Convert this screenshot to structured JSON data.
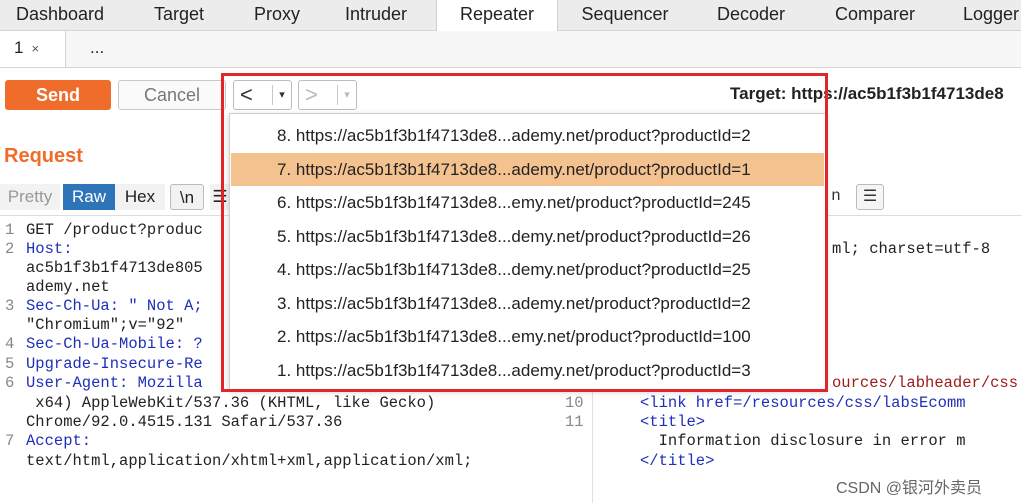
{
  "tabs": [
    {
      "label": "Dashboard",
      "active": false
    },
    {
      "label": "Target",
      "active": false
    },
    {
      "label": "Proxy",
      "active": false
    },
    {
      "label": "Intruder",
      "active": false
    },
    {
      "label": "Repeater",
      "active": true
    },
    {
      "label": "Sequencer",
      "active": false
    },
    {
      "label": "Decoder",
      "active": false
    },
    {
      "label": "Comparer",
      "active": false
    },
    {
      "label": "Logger",
      "active": false
    }
  ],
  "subtabs": {
    "tab1": "1",
    "close": "×",
    "more": "..."
  },
  "toolbar": {
    "send": "Send",
    "cancel": "Cancel",
    "target": "Target: https://ac5b1f3b1f4713de8"
  },
  "nav": {
    "back": "<",
    "forward": ">",
    "drop": "▾"
  },
  "request": {
    "title": "Request",
    "views": [
      "Pretty",
      "Raw",
      "Hex",
      "\\n",
      "☰"
    ],
    "active_view": "Raw",
    "lines": [
      {
        "num": "1",
        "text": "GET /product?produc"
      },
      {
        "num": "2",
        "text": "Host:"
      },
      {
        "num": "",
        "text": "ac5b1f3b1f4713de805"
      },
      {
        "num": "",
        "text": "ademy.net"
      },
      {
        "num": "3",
        "text": "Sec-Ch-Ua: \" Not A;"
      },
      {
        "num": "",
        "text": "\"Chromium\";v=\"92\""
      },
      {
        "num": "4",
        "text": "Sec-Ch-Ua-Mobile: ?"
      },
      {
        "num": "5",
        "text": "Upgrade-Insecure-Re"
      },
      {
        "num": "6",
        "text": "User-Agent: Mozilla"
      },
      {
        "num": "",
        "text": " x64) AppleWebKit/537.36 (KHTML, like Gecko)"
      },
      {
        "num": "",
        "text": "Chrome/92.0.4515.131 Safari/537.36"
      },
      {
        "num": "7",
        "text": "Accept:"
      },
      {
        "num": "",
        "text": "text/html,application/xhtml+xml,application/xml;"
      }
    ]
  },
  "response": {
    "view_icons": [
      "n",
      "☰"
    ],
    "line_right_top": "ml; charset=utf-8",
    "line_css": "ources/labheader/css",
    "line_nums": [
      "10",
      "11"
    ],
    "line10": "<link href=/resources/css/labsEcomm",
    "line11a": "<title>",
    "line11b": "  Information disclosure in error m",
    "line11c": "</title>"
  },
  "history": [
    {
      "label": "8. https://ac5b1f3b1f4713de8...ademy.net/product?productId=2",
      "selected": false
    },
    {
      "label": "7. https://ac5b1f3b1f4713de8...ademy.net/product?productId=1",
      "selected": true
    },
    {
      "label": "6. https://ac5b1f3b1f4713de8...emy.net/product?productId=245",
      "selected": false
    },
    {
      "label": "5. https://ac5b1f3b1f4713de8...demy.net/product?productId=26",
      "selected": false
    },
    {
      "label": "4. https://ac5b1f3b1f4713de8...demy.net/product?productId=25",
      "selected": false
    },
    {
      "label": "3. https://ac5b1f3b1f4713de8...ademy.net/product?productId=2",
      "selected": false
    },
    {
      "label": "2. https://ac5b1f3b1f4713de8...emy.net/product?productId=100",
      "selected": false
    },
    {
      "label": "1. https://ac5b1f3b1f4713de8...ademy.net/product?productId=3",
      "selected": false
    }
  ],
  "watermark": "CSDN @银河外卖员",
  "colors": {
    "accent": "#f06c2b",
    "selected_row": "#f4c28f",
    "highlight_box": "#e3242b",
    "raw_tab": "#2d74b8"
  }
}
